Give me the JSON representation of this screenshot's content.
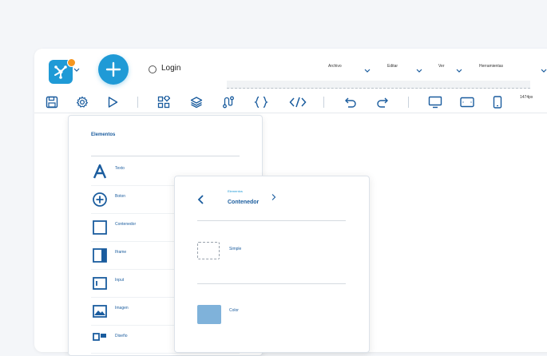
{
  "header": {
    "logo_icon": "share-nodes-icon",
    "add_icon": "plus-icon",
    "login_label": "Login",
    "menus": [
      {
        "label": "Archivo"
      },
      {
        "label": "Editar"
      },
      {
        "label": "Ver"
      },
      {
        "label": "Herramientas"
      }
    ]
  },
  "toolbar": {
    "icons": [
      "save-icon",
      "settings-icon",
      "play-icon",
      "elements-icon",
      "layers-icon",
      "route-icon",
      "braces-icon",
      "code-icon",
      "undo-icon",
      "redo-icon",
      "desktop-icon",
      "tablet-icon",
      "mobile-icon"
    ],
    "zoom_label": "1474px"
  },
  "elements_panel": {
    "title": "Elementos",
    "items": [
      {
        "label": "Texto",
        "icon": "text-icon"
      },
      {
        "label": "Boton",
        "icon": "plus-circle-icon"
      },
      {
        "label": "Contenedor",
        "icon": "square-icon"
      },
      {
        "label": "Iframe",
        "icon": "iframe-icon"
      },
      {
        "label": "Input",
        "icon": "input-icon"
      },
      {
        "label": "Imagen",
        "icon": "image-icon"
      },
      {
        "label": "Diseño",
        "icon": "layout-icon"
      }
    ]
  },
  "container_panel": {
    "breadcrumb": "Elementos",
    "title": "Contenedor",
    "options": [
      {
        "label": "Simple"
      },
      {
        "label": "Color"
      }
    ]
  },
  "colors": {
    "primary": "#1f9ad6",
    "dark_blue": "#1a5c9e",
    "accent_orange": "#f5961f",
    "color_swatch": "#7fb2da"
  }
}
